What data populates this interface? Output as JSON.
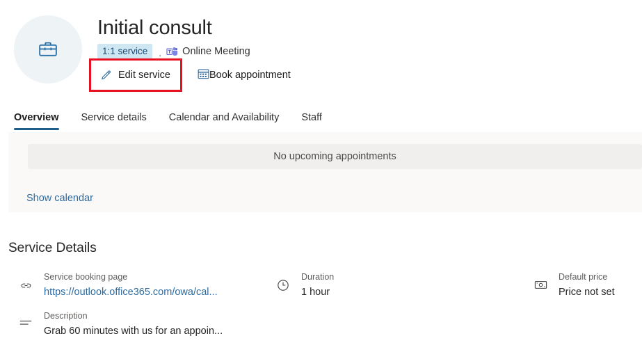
{
  "header": {
    "avatar_icon": "briefcase-icon",
    "title": "Initial consult",
    "badge": "1:1 service",
    "separator": ".",
    "meeting_type": "Online Meeting",
    "meeting_type_icon": "teams-icon",
    "edit_label": "Edit service",
    "edit_icon": "pencil-icon",
    "book_label": "Book appointment",
    "book_icon": "calendar-icon",
    "highlight_color": "#e81123",
    "badge_bg": "#cfe6f3",
    "badge_fg": "#1a4a6e",
    "avatar_bg": "#eef3f6",
    "avatar_fg": "#2e73a8"
  },
  "tabs": [
    {
      "label": "Overview",
      "active": true
    },
    {
      "label": "Service details",
      "active": false
    },
    {
      "label": "Calendar and Availability",
      "active": false
    },
    {
      "label": "Staff",
      "active": false
    }
  ],
  "appointments": {
    "empty_text": "No upcoming appointments",
    "show_calendar_label": "Show calendar",
    "panel_bg": "#faf9f8",
    "empty_bg": "#f0efee",
    "link_color": "#2c6aa0"
  },
  "service_details": {
    "heading": "Service Details",
    "items": [
      {
        "icon": "link-icon",
        "label": "Service booking page",
        "value": "https://outlook.office365.com/owa/cal...",
        "is_link": true
      },
      {
        "icon": "clock-icon",
        "label": "Duration",
        "value": "1 hour",
        "is_link": false
      },
      {
        "icon": "money-icon",
        "label": "Default price",
        "value": "Price not set",
        "is_link": false
      },
      {
        "icon": "description-lines-icon",
        "label": "Description",
        "value": "Grab 60 minutes with us for an appoin...",
        "is_link": false
      }
    ]
  }
}
